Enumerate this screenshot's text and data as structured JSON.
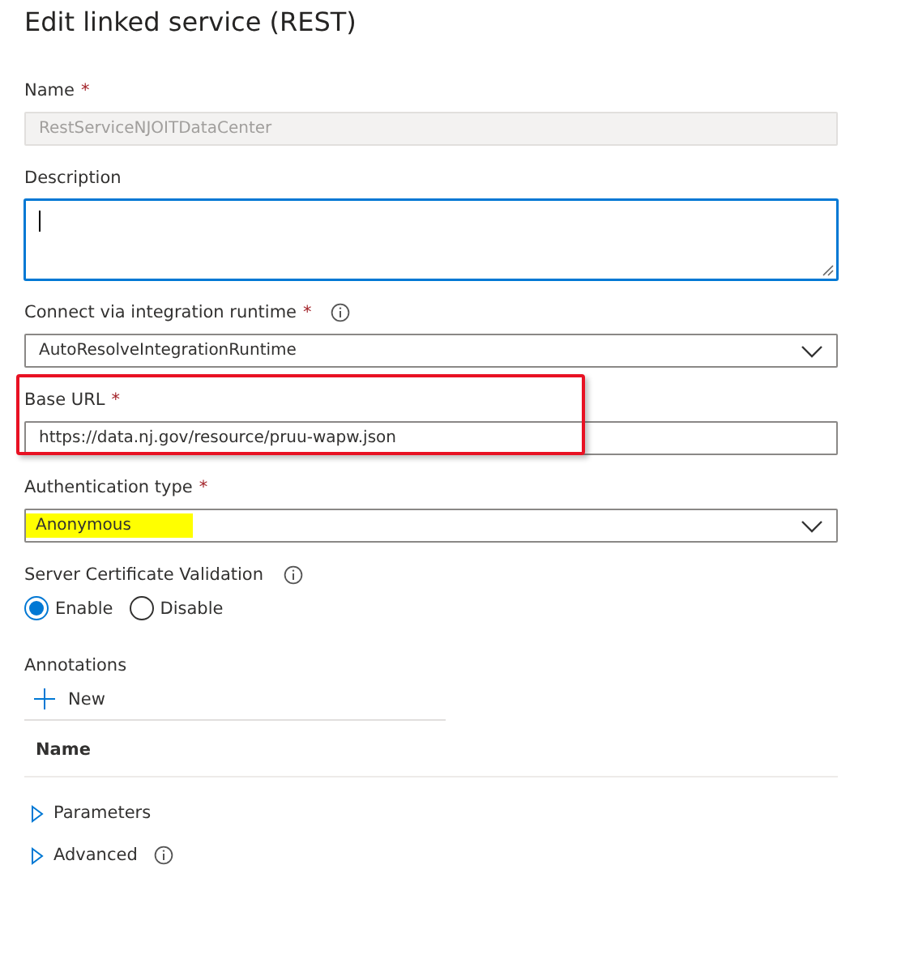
{
  "title": "Edit linked service (REST)",
  "fields": [
    {
      "kind": "text",
      "label": "Name",
      "required_mark": "*",
      "value": "RestServiceNJOITDataCenter",
      "disabled": true
    },
    {
      "kind": "textarea",
      "label": "Description",
      "focused": true
    },
    {
      "kind": "select",
      "label": "Connect via integration runtime",
      "required_mark": "*",
      "info": true,
      "value": "AutoResolveIntegrationRuntime"
    },
    {
      "kind": "text",
      "label": "Base URL",
      "required_mark": "*",
      "value": "https://data.nj.gov/resource/pruu-wapw.json",
      "disabled": false,
      "outlined": true
    },
    {
      "kind": "select",
      "label": "Authentication type",
      "required_mark": "*",
      "value": "Anonymous",
      "highlighted": true
    },
    {
      "kind": "radio",
      "label": "Server Certificate Validation",
      "info": true,
      "options": [
        {
          "label": "Enable",
          "selected": true
        },
        {
          "label": "Disable",
          "selected": false
        }
      ]
    }
  ],
  "annotations": {
    "label": "Annotations",
    "new_button": "New",
    "columns": [
      "Name"
    ]
  },
  "sections": [
    {
      "label": "Parameters",
      "expanded": false,
      "info": false
    },
    {
      "label": "Advanced",
      "expanded": false,
      "info": true
    }
  ]
}
